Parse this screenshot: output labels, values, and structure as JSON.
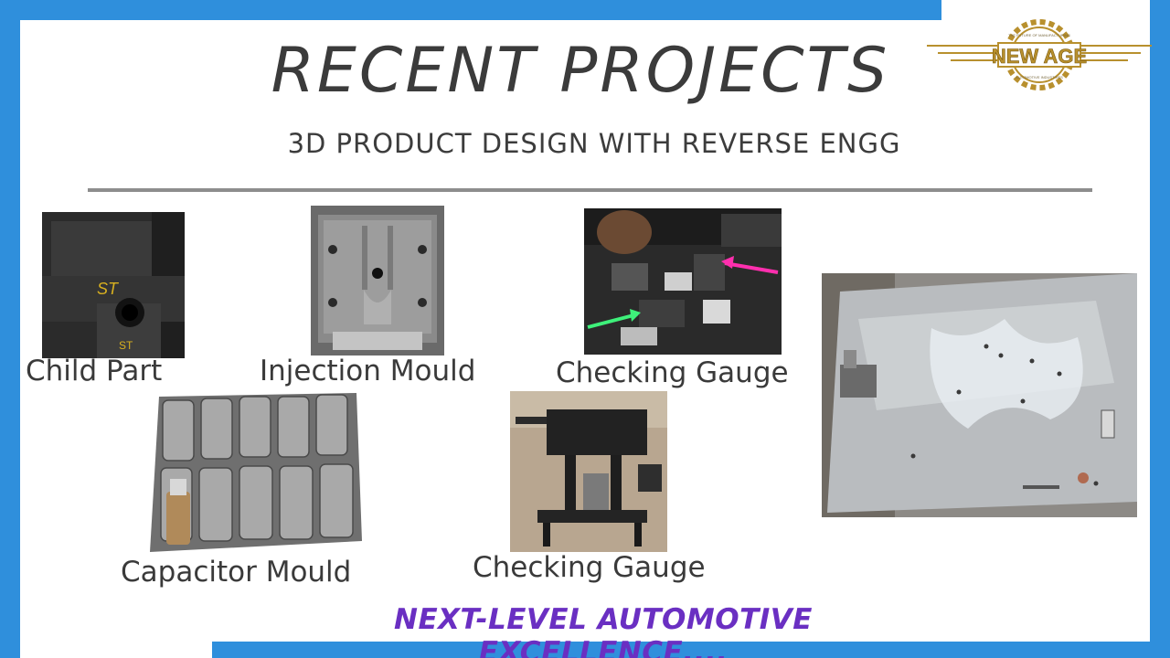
{
  "slide": {
    "title": "RECENT PROJECTS",
    "subtitle": "3D PRODUCT DESIGN WITH REVERSE ENGG",
    "tagline": "NEXT-LEVEL AUTOMOTIVE EXCELLENCE...."
  },
  "logo": {
    "name": "NEW AGE",
    "tagline": "THE FUTURE OF MANUFACTURING",
    "subline": "AUTOMOTIVE INDUSTRIES"
  },
  "projects": [
    {
      "caption": "Child Part"
    },
    {
      "caption": "Injection Mould"
    },
    {
      "caption": "Checking Gauge"
    },
    {
      "caption": "Capacitor Mould"
    },
    {
      "caption": "Checking Gauge"
    },
    {
      "caption": ""
    }
  ],
  "colors": {
    "frame": "#2f8fdc",
    "title": "#3b3b3b",
    "divider": "#8d8d8d",
    "tagline": "#6a2fc2",
    "logo_gold": "#b8902e"
  }
}
